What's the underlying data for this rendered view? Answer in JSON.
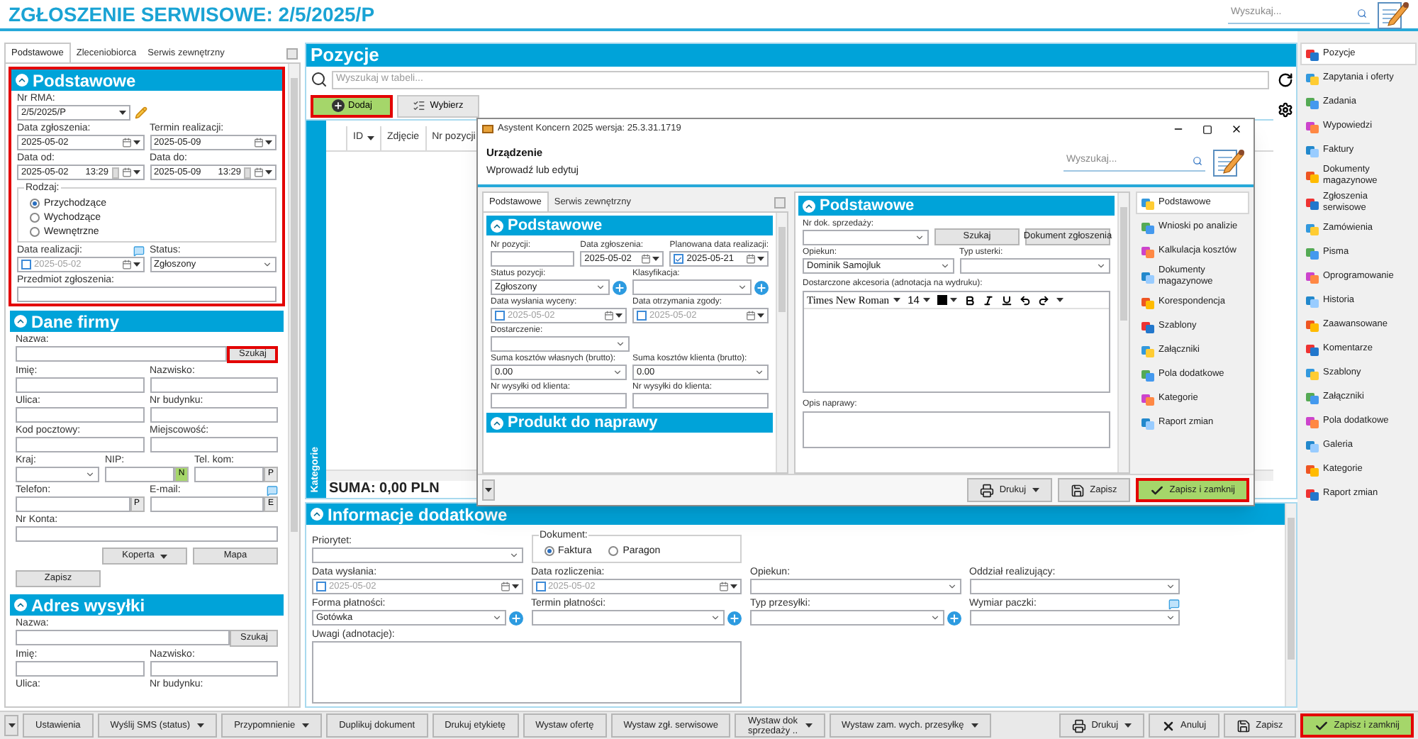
{
  "header": {
    "title": "ZGŁOSZENIE SERWISOWE: 2/5/2025/P",
    "search_placeholder": "Wyszukaj..."
  },
  "left_panel": {
    "tabs": [
      {
        "label": "Podstawowe",
        "selected": true
      },
      {
        "label": "Zleceniobiorca",
        "selected": false
      },
      {
        "label": "Serwis zewnętrzny",
        "selected": false
      }
    ],
    "sections": [
      {
        "title": "Podstawowe",
        "highlighted": true,
        "rows": [
          [
            {
              "kind": "readonly",
              "label": "Nr RMA:",
              "value": "2/5/2025/P"
            }
          ],
          [
            {
              "kind": "date",
              "label": "Data zgłoszenia:",
              "value": "2025-05-02"
            },
            {
              "kind": "date",
              "label": "Termin realizacji:",
              "value": "2025-05-09"
            }
          ],
          [
            {
              "kind": "date",
              "label": "Data od:",
              "value": "2025-05-02",
              "time": "13:29"
            },
            {
              "kind": "date",
              "label": "Data do:",
              "value": "2025-05-09",
              "time": "13:29"
            }
          ],
          [
            {
              "kind": "radio",
              "label": "Rodzaj:",
              "options": [
                {
                  "label": "Przychodzące",
                  "selected": true
                },
                {
                  "label": "Wychodzące",
                  "selected": false
                },
                {
                  "label": "Wewnętrzne",
                  "selected": false
                }
              ]
            }
          ],
          [
            {
              "kind": "date",
              "label": "Data realizacji:",
              "value": "2025-05-02",
              "checked": false,
              "comment": true
            },
            {
              "kind": "select",
              "label": "Status:",
              "value": "Zgłoszony"
            }
          ],
          [
            {
              "kind": "text",
              "label": "Przedmiot zgłoszenia:"
            }
          ]
        ]
      },
      {
        "title": "Dane firmy",
        "highlighted": false,
        "rows": [
          [
            {
              "kind": "text",
              "label": "Nazwa:",
              "action": {
                "label": "Szukaj",
                "highlighted": true
              }
            }
          ],
          [
            {
              "kind": "text",
              "label": "Imię:"
            },
            {
              "kind": "text",
              "label": "Nazwisko:"
            }
          ],
          [
            {
              "kind": "text",
              "label": "Ulica:"
            },
            {
              "kind": "text",
              "label": "Nr budynku:"
            }
          ],
          [
            {
              "kind": "text",
              "label": "Kod pocztowy:"
            },
            {
              "kind": "text",
              "label": "Miejscowość:"
            }
          ],
          [
            {
              "kind": "select",
              "label": "Kraj:"
            },
            {
              "kind": "text",
              "label": "NIP:",
              "suffix": {
                "label": "N",
                "color": "#a5d66a"
              }
            },
            {
              "kind": "text",
              "label": "Tel. kom:",
              "suffix": {
                "label": "P",
                "color": "#e8e8e8"
              }
            }
          ],
          [
            {
              "kind": "text",
              "label": "Telefon:",
              "suffix": {
                "label": "P",
                "color": "#e8e8e8"
              }
            },
            {
              "kind": "text",
              "label": "E-mail:",
              "suffix": {
                "label": "E",
                "color": "#e8e8e8"
              },
              "comment": true
            }
          ],
          [
            {
              "kind": "text",
              "label": "Nr Konta:"
            }
          ],
          [
            {
              "kind": "button",
              "label": "Koperta",
              "dropdown": true
            },
            {
              "kind": "button",
              "label": "Mapa",
              "dropdown": false
            }
          ],
          [
            {
              "kind": "button",
              "label": "Zapisz",
              "dropdown": false
            }
          ]
        ]
      },
      {
        "title": "Adres wysyłki",
        "highlighted": false,
        "rows": [
          [
            {
              "kind": "text",
              "label": "Nazwa:",
              "action": {
                "label": "Szukaj",
                "highlighted": false
              }
            }
          ],
          [
            {
              "kind": "text",
              "label": "Imię:"
            },
            {
              "kind": "text",
              "label": "Nazwisko:"
            }
          ],
          [
            {
              "kind": "label",
              "label": "Ulica:"
            },
            {
              "kind": "label",
              "label": "Nr budynku:"
            }
          ]
        ]
      }
    ]
  },
  "positions": {
    "title": "Pozycje",
    "search_placeholder": "Wyszukaj w tabeli...",
    "buttons": [
      {
        "kind": "add",
        "label": "Dodaj",
        "highlighted": true
      },
      {
        "kind": "pick",
        "label": "Wybierz",
        "highlighted": false
      }
    ],
    "columns": [
      {
        "label": "ID",
        "sorted": true
      },
      {
        "label": "Zdjęcie",
        "sorted": false
      },
      {
        "label": "Nr pozycji",
        "sorted": false
      }
    ],
    "side_label": "Kategorie",
    "sum": "SUMA: 0,00 PLN"
  },
  "details": {
    "title": "Informacje dodatkowe",
    "rows": [
      [
        {
          "kind": "select",
          "label": "Priorytet:"
        },
        {
          "kind": "radio_inline",
          "label": "Dokument:",
          "options": [
            {
              "label": "Faktura",
              "selected": true
            },
            {
              "label": "Paragon",
              "selected": false
            }
          ]
        }
      ],
      [
        {
          "kind": "date",
          "label": "Data wysłania:",
          "value": "2025-05-02",
          "checked": false
        },
        {
          "kind": "date",
          "label": "Data rozliczenia:",
          "value": "2025-05-02",
          "checked": false
        },
        {
          "kind": "select",
          "label": "Opiekun:"
        },
        {
          "kind": "select",
          "label": "Oddział realizujący:"
        }
      ],
      [
        {
          "kind": "select",
          "label": "Forma płatności:",
          "value": "Gotówka",
          "plus": true
        },
        {
          "kind": "select",
          "label": "Termin płatności:",
          "plus": true
        },
        {
          "kind": "select",
          "label": "Typ przesyłki:",
          "plus": true
        },
        {
          "kind": "select",
          "label": "Wymiar paczki:",
          "comment": true
        }
      ],
      [
        {
          "kind": "textarea",
          "label": "Uwagi (adnotacje):"
        }
      ]
    ]
  },
  "modules": [
    {
      "label": "Pozycje",
      "selected": true
    },
    {
      "label": "Zapytania i oferty",
      "selected": false
    },
    {
      "label": "Zadania",
      "selected": false
    },
    {
      "label": "Wypowiedzi",
      "selected": false
    },
    {
      "label": "Faktury",
      "selected": false
    },
    {
      "label": "Dokumenty\nmagazynowe",
      "selected": false
    },
    {
      "label": "Zgłoszenia serwisowe",
      "selected": false
    },
    {
      "label": "Zamówienia",
      "selected": false
    },
    {
      "label": "Pisma",
      "selected": false
    },
    {
      "label": "Oprogramowanie",
      "selected": false
    },
    {
      "label": "Historia",
      "selected": false
    },
    {
      "label": "Zaawansowane",
      "selected": false
    },
    {
      "label": "Komentarze",
      "selected": false
    },
    {
      "label": "Szablony",
      "selected": false
    },
    {
      "label": "Załączniki",
      "selected": false
    },
    {
      "label": "Pola dodatkowe",
      "selected": false
    },
    {
      "label": "Galeria",
      "selected": false
    },
    {
      "label": "Kategorie",
      "selected": false
    },
    {
      "label": "Raport zmian",
      "selected": false
    }
  ],
  "dialog": {
    "title": "Asystent Koncern 2025 wersja: 25.3.31.1719",
    "heading": "Urządzenie",
    "subheading": "Wprowadź lub edytuj",
    "search_placeholder": "Wyszukaj...",
    "tabs": [
      {
        "label": "Podstawowe",
        "selected": true
      },
      {
        "label": "Serwis zewnętrzny",
        "selected": false
      }
    ],
    "left_section": {
      "title": "Podstawowe",
      "rows": [
        [
          {
            "kind": "text",
            "label": "Nr pozycji:"
          },
          {
            "kind": "date",
            "label": "Data zgłoszenia:",
            "value": "2025-05-02"
          },
          {
            "kind": "date",
            "label": "Planowana data realizacji:",
            "value": "2025-05-21",
            "checked": true
          }
        ],
        [
          {
            "kind": "select",
            "label": "Status pozycji:",
            "value": "Zgłoszony",
            "plus": true
          },
          {
            "kind": "select",
            "label": "Klasyfikacja:",
            "plus": true
          }
        ],
        [
          {
            "kind": "date",
            "label": "Data wysłania wyceny:",
            "value": "2025-05-02",
            "checked": false
          },
          {
            "kind": "date",
            "label": "Data otrzymania zgody:",
            "value": "2025-05-02",
            "checked": false
          }
        ],
        [
          {
            "kind": "select",
            "label": "Dostarczenie:"
          }
        ],
        [
          {
            "kind": "select",
            "label": "Suma kosztów własnych (brutto):",
            "value": "0.00"
          },
          {
            "kind": "select",
            "label": "Suma kosztów klienta (brutto):",
            "value": "0.00"
          }
        ],
        [
          {
            "kind": "text",
            "label": "Nr wysyłki od klienta:"
          },
          {
            "kind": "text",
            "label": "Nr wysyłki do klienta:"
          }
        ]
      ]
    },
    "next_section": "Produkt do naprawy",
    "right_section": {
      "title": "Podstawowe",
      "rows": [
        [
          {
            "kind": "select",
            "label": "Nr dok. sprzedaży:"
          },
          {
            "kind": "button",
            "label": "Szukaj",
            "dropdown": false
          },
          {
            "kind": "button",
            "label": "Dokument zgłoszenia",
            "dropdown": false
          }
        ],
        [
          {
            "kind": "select",
            "label": "Opiekun:",
            "value": "Dominik Samojluk"
          },
          {
            "kind": "select",
            "label": "Typ usterki:"
          }
        ]
      ],
      "editor": {
        "label": "Dostarczone akcesoria (adnotacja na wydruku):",
        "font": "Times New Roman",
        "size": "14"
      },
      "notes_label": "Opis naprawy:"
    },
    "nav": [
      {
        "label": "Podstawowe",
        "selected": true
      },
      {
        "label": "Wnioski po analizie",
        "selected": false
      },
      {
        "label": "Kalkulacja kosztów",
        "selected": false
      },
      {
        "label": "Dokumenty\nmagazynowe",
        "selected": false
      },
      {
        "label": "Korespondencja",
        "selected": false
      },
      {
        "label": "Szablony",
        "selected": false
      },
      {
        "label": "Załączniki",
        "selected": false
      },
      {
        "label": "Pola dodatkowe",
        "selected": false
      },
      {
        "label": "Kategorie",
        "selected": false
      },
      {
        "label": "Raport zmian",
        "selected": false
      }
    ],
    "footer": [
      {
        "kind": "print",
        "label": "Drukuj",
        "highlighted": false
      },
      {
        "kind": "save",
        "label": "Zapisz",
        "highlighted": false
      },
      {
        "kind": "save_close",
        "label": "Zapisz i zamknij",
        "highlighted": true
      }
    ]
  },
  "toolbar_left": [
    {
      "label": "Ustawienia",
      "dropdown": false
    },
    {
      "label": "Wyślij SMS (status)",
      "dropdown": true
    },
    {
      "label": "Przypomnienie",
      "dropdown": true
    },
    {
      "label": "Duplikuj dokument",
      "dropdown": false
    },
    {
      "label": "Drukuj etykietę",
      "dropdown": false
    },
    {
      "label": "Wystaw ofertę",
      "dropdown": false
    },
    {
      "label": "Wystaw zgł. serwisowe",
      "dropdown": false
    },
    {
      "label": "Wystaw dok\nsprzedaży ..",
      "dropdown": true
    },
    {
      "label": "Wystaw zam. wych. przesyłkę",
      "dropdown": true
    }
  ],
  "toolbar_right": [
    {
      "kind": "print",
      "label": "Drukuj",
      "highlighted": false
    },
    {
      "kind": "cancel",
      "label": "Anuluj",
      "highlighted": false
    },
    {
      "kind": "save",
      "label": "Zapisz",
      "highlighted": false
    },
    {
      "kind": "save_close",
      "label": "Zapisz i zamknij",
      "highlighted": true
    }
  ]
}
